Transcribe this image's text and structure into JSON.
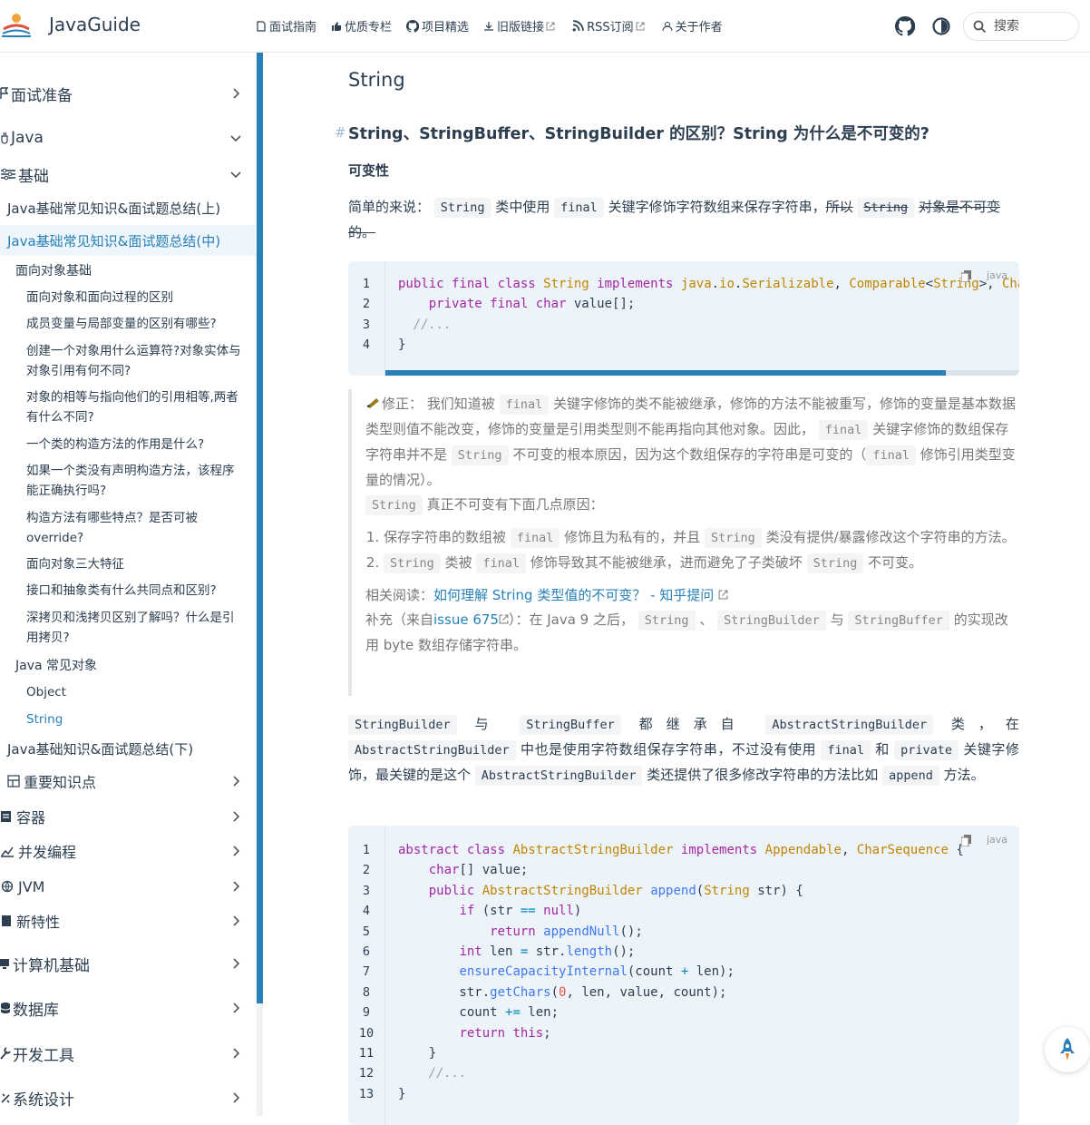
{
  "navbar": {
    "site_title": "JavaGuide",
    "links": [
      {
        "label": "面试指南",
        "icon": "book-icon",
        "external": false
      },
      {
        "label": "优质专栏",
        "icon": "thumb-icon",
        "external": false
      },
      {
        "label": "项目精选",
        "icon": "github-icon",
        "external": false
      },
      {
        "label": "旧版链接",
        "icon": "archive-icon",
        "external": true
      },
      {
        "label": "RSS订阅",
        "icon": "rss-icon",
        "external": true
      },
      {
        "label": "关于作者",
        "icon": "person-icon",
        "external": false
      }
    ],
    "search_placeholder": "搜索"
  },
  "sidebar": {
    "groups": {
      "interview_prep": "面试准备",
      "java": "Java",
      "basics": "基础",
      "important": "重要知识点",
      "collections": "容器",
      "concurrency": "并发编程",
      "jvm": "JVM",
      "new_features": "新特性",
      "cs_basics": "计算机基础",
      "database": "数据库",
      "dev_tools": "开发工具",
      "system_design": "系统设计"
    },
    "pages": {
      "basics_part1": "Java基础常见知识&面试题总结(上)",
      "basics_part2": "Java基础常见知识&面试题总结(中)",
      "basics_part3": "Java基础知识&面试题总结(下)"
    },
    "oop_heading": "面向对象基础",
    "oop_items": [
      "面向对象和面向过程的区别",
      "成员变量与局部变量的区别有哪些?",
      "创建一个对象用什么运算符?对象实体与对象引用有何不同?",
      "对象的相等与指向他们的引用相等,两者有什么不同?",
      "一个类的构造方法的作用是什么?",
      "如果一个类没有声明构造方法，该程序能正确执行吗?",
      "构造方法有哪些特点？是否可被 override?",
      "面向对象三大特征",
      "接口和抽象类有什么共同点和区别?",
      "深拷贝和浅拷贝区别了解吗？什么是引用拷贝?"
    ],
    "common_heading": "Java 常见对象",
    "common_items": [
      "Object",
      "String"
    ]
  },
  "content": {
    "h2": "String",
    "h3_anchor": "#",
    "h3": "String、StringBuffer、StringBuilder 的区别？String 为什么是不可变的?",
    "h4": "可变性",
    "p1": {
      "t1": "简单的来说：",
      "c1": "String",
      "t2": "类中使用",
      "c2": "final",
      "t3": "关键字修饰字符数组来保存字符串，",
      "s1": "所以",
      "c3": "String",
      "s2": "对象是不可变的。"
    },
    "code1": {
      "lang": "java",
      "line_numbers": [
        "1",
        "2",
        "3",
        "4"
      ]
    },
    "quote": {
      "fix_label": "修正：",
      "q1": "我们知道被",
      "c1": "final",
      "q2": "关键字修饰的类不能被继承，修饰的方法不能被重写，修饰的变量是基本数据类型则值不能改变，修饰的变量是引用类型则不能再指向其他对象。因此，",
      "c2": "final",
      "q3": "关键字修饰的数组保存字符串并不是",
      "c3": "String",
      "q4": "不可变的根本原因，因为这个数组保存的字符串是可变的（",
      "c4": "final",
      "q5": "修饰引用类型变量的情况）。",
      "c5": "String",
      "q6": "真正不可变有下面几点原因：",
      "li1": {
        "t1": "保存字符串的数组被",
        "c1": "final",
        "t2": "修饰且为私有的，并且",
        "c2": "String",
        "t3": "类没有提供/暴露修改这个字符串的方法。"
      },
      "li2": {
        "c1": "String",
        "t1": "类被",
        "c2": "final",
        "t2": "修饰导致其不能被继承，进而避免了子类破坏",
        "c3": "String",
        "t3": "不可变。"
      },
      "related_label": "相关阅读：",
      "related_link": "如何理解 String 类型值的不可变？ - 知乎提问",
      "supp_t1": "补充（来自",
      "supp_link": "issue 675",
      "supp_t2": "）：在 Java 9 之后，",
      "supp_c1": "String",
      "supp_t3": "、",
      "supp_c2": "StringBuilder",
      "supp_t4": "与",
      "supp_c3": "StringBuffer",
      "supp_t5": "的实现改用 byte 数组存储字符串。"
    },
    "p2": {
      "c1": "StringBuilder",
      "t1": "与",
      "c2": "StringBuffer",
      "t2": "都继承自",
      "c3": "AbstractStringBuilder",
      "t3": "类，在",
      "c4": "AbstractStringBuilder",
      "t4": "中也是使用字符数组保存字符串，不过没有使用",
      "c5": "final",
      "t5": "和",
      "c6": "private",
      "t6": "关键字修饰，最关键的是这个",
      "c7": "AbstractStringBuilder",
      "t7": "类还提供了很多修改字符串的方法比如",
      "c8": "append",
      "t8": "方法。"
    },
    "code2": {
      "lang": "java",
      "line_numbers": [
        "1",
        "2",
        "3",
        "4",
        "5",
        "6",
        "7",
        "8",
        "9",
        "10",
        "11",
        "12",
        "13"
      ]
    }
  },
  "colors": {
    "accent": "#2980b9",
    "code_bg": "#ecf4fa",
    "text": "#2c3e50"
  }
}
